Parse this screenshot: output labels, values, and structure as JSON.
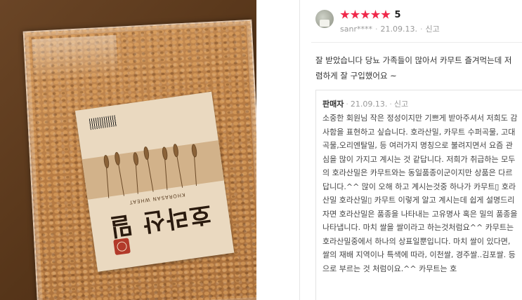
{
  "photo": {
    "product_label_korean": "호라산 밀",
    "product_label_english": "KHORASAN WHEAT",
    "colors": {
      "bag": "#b87d45",
      "background": "#563519",
      "label": "#ead9c0"
    }
  },
  "review": {
    "rating_stars": 5,
    "rating_text": "5",
    "username": "sanr****",
    "date": "21.09.13.",
    "report_label": "신고",
    "text": "잘 받았습니다 당뇨 가족들이 많아서 카무트 즐겨먹는데 저렴하게 잘 구입했어요 ~",
    "star_color": "#f0284a"
  },
  "seller_reply": {
    "author": "판매자",
    "date": "21.09.13.",
    "report_label": "신고",
    "text": "소중한 회원님 작은 정성이지만 기쁘게 받아주셔서 저희도 감사함을 표현하고 싶습니다. 호라산밀, 카무트 수퍼곡물, 고대곡물,오리엔탈밀, 등 여러가지 명칭으로 불려지면서 요즘 관심을 많이 가지고 계시는 것 같답니다. 저희가 취급하는 모두의 호라산밀은 카무트와는 동일품종이군이지만 상품은 다르답니다.^^ 많이 오해 하고 계시는것중 하나가 카무트▯ 호라산밀 호라산밀▯ 카무트 이렇게 알고 계시는데 쉽게 설명드리자면 호라산밀은 품종을 나타내는 고유명사 혹은 밀의 품종을 나타냅니다. 마치 쌀을 쌀이라고 하는것처럼요^^ 카무트는 호라산밀중에서 하나의 상표일뿐입니다. 마치 쌀이 있다면, 쌀의 재배 지역이나 특색에 따라, 이천쌀, 경주쌀..김포쌀. 등으로 부르는 것 처럼이요.^^ 카무트는 호"
  }
}
